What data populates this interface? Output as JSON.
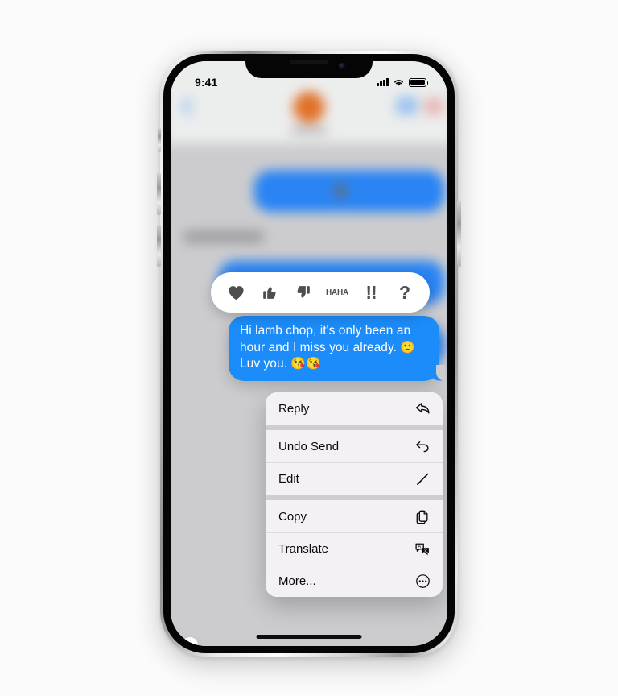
{
  "scene": {
    "background_color": "#fbfbfb",
    "device": "iphone",
    "screen_background": "#ccccce"
  },
  "status_bar": {
    "time": "9:41",
    "signal_icon": "cellular-signal-icon",
    "wifi_icon": "wifi-icon",
    "battery_icon": "battery-icon"
  },
  "conversation_backdrop": {
    "back_icon": "chevron-left-icon",
    "avatar": "contact-avatar",
    "avatar_color": "#e2712a",
    "bubble_color": "#2a84f4"
  },
  "tapbacks": {
    "items": [
      {
        "name": "heart",
        "icon": "heart-icon",
        "label": ""
      },
      {
        "name": "thumbs-up",
        "icon": "thumbs-up-icon",
        "label": ""
      },
      {
        "name": "thumbs-down",
        "icon": "thumbs-down-icon",
        "label": ""
      },
      {
        "name": "haha",
        "icon": "haha-icon",
        "line1": "HA",
        "line2": "HA"
      },
      {
        "name": "exclamation",
        "icon": "double-exclamation-icon",
        "label": "!!"
      },
      {
        "name": "question",
        "icon": "question-mark-icon",
        "label": "?"
      }
    ]
  },
  "message": {
    "line1": "Hi lamb chop, it's only been an",
    "line2": "hour and I miss you already.",
    "emoji_sad": "🙁",
    "line3": "Luv you.",
    "emoji_kiss1": "😘",
    "emoji_kiss2": "😘",
    "bubble_color": "#1b8cf9",
    "sender": "me"
  },
  "context_menu": {
    "groups": [
      {
        "items": [
          {
            "label": "Reply",
            "icon": "reply-arrow-icon"
          }
        ]
      },
      {
        "items": [
          {
            "label": "Undo Send",
            "icon": "undo-arrow-icon"
          },
          {
            "label": "Edit",
            "icon": "pencil-icon"
          }
        ]
      },
      {
        "items": [
          {
            "label": "Copy",
            "icon": "copy-documents-icon"
          },
          {
            "label": "Translate",
            "icon": "translate-bubbles-icon"
          },
          {
            "label": "More...",
            "icon": "ellipsis-circle-icon"
          }
        ]
      }
    ]
  },
  "home_indicator": "home-indicator-bar"
}
